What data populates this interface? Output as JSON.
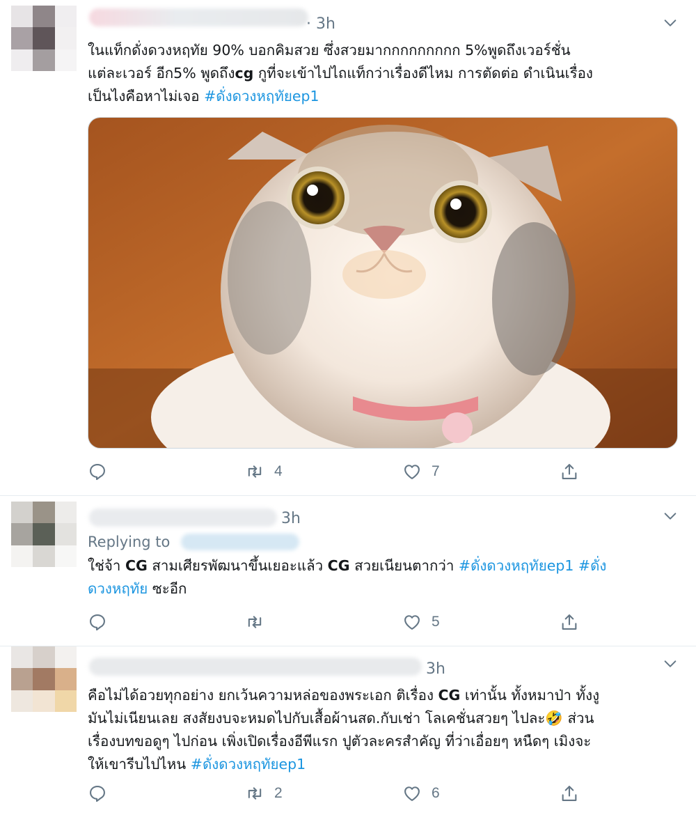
{
  "tweets": [
    {
      "time": "· 3h",
      "text": [
        {
          "t": "ในแท็กดั่งดวงหฤทัย 90% บอกคิมสวย ซึ่งสวยมากกกกกกกกก 5%พูดถึงเวอร์ชั่น",
          "s": "plain",
          "br": true
        },
        {
          "t": "แต่ละเวอร์ อีก5% พูดถึง",
          "s": "plain"
        },
        {
          "t": "cg",
          "s": "bold"
        },
        {
          "t": " กูที่จะเข้าไปไถแท็กว่าเรื่องดีไหม การตัดต่อ ดำเนินเรื่อง",
          "s": "plain",
          "br": true
        },
        {
          "t": "เป็นไงคือหาไม่เจอ ",
          "s": "plain"
        },
        {
          "t": "#ดั่งดวงหฤทัยep1",
          "s": "tag"
        }
      ],
      "retweets": "4",
      "likes": "7"
    },
    {
      "time": "3h",
      "replying_label": "Replying to",
      "text": [
        {
          "t": "ใช่จ้า ",
          "s": "plain"
        },
        {
          "t": "CG",
          "s": "bold"
        },
        {
          "t": " สามเศียรพัฒนาขึ้นเยอะแล้ว ",
          "s": "plain"
        },
        {
          "t": "CG",
          "s": "bold"
        },
        {
          "t": " สวยเนียนตากว่า ",
          "s": "plain"
        },
        {
          "t": "#ดั่งดวงหฤทัยep1",
          "s": "tag"
        },
        {
          "t": " #ดั่ง",
          "s": "tag",
          "br": true
        },
        {
          "t": "ดวงหฤทัย",
          "s": "tag"
        },
        {
          "t": " ซะอีก",
          "s": "plain"
        }
      ],
      "retweets": "",
      "likes": "5"
    },
    {
      "time": "3h",
      "text": [
        {
          "t": "คือไม่ได้อวยทุกอย่าง ยกเว้นความหล่อของพระเอก ติเรื่อง ",
          "s": "plain"
        },
        {
          "t": "CG",
          "s": "bold"
        },
        {
          "t": " เท่านั้น ทั้งหมาป่า ทั้งงู",
          "s": "plain",
          "br": true
        },
        {
          "t": "มันไม่เนียนเลย สงสัยงบจะหมดไปกับเสื้อผ้านสด.กับเช่า โลเคชั่นสวยๆ ไปละ🤣 ส่วน",
          "s": "plain",
          "br": true
        },
        {
          "t": "เรื่องบทขอดูๆ ไปก่อน เพิ่งเปิดเรื่องอีพีแรก ปูตัวละครสำคัญ ที่ว่าเอื่อยๆ หนืดๆ เมิงจะ",
          "s": "plain",
          "br": true
        },
        {
          "t": "ให้เขารีบไปไหน ",
          "s": "plain"
        },
        {
          "t": "#ดั่งดวงหฤทัยep1",
          "s": "tag"
        }
      ],
      "retweets": "2",
      "likes": "6"
    }
  ],
  "icons": {
    "reply": "comment-icon",
    "retweet": "retweet-icon",
    "like": "heart-icon",
    "share": "share-icon",
    "more": "chevron-down-icon"
  },
  "colors": {
    "link": "#1b95e0",
    "muted": "#657786",
    "text": "#14171a",
    "divider": "#e6ecf0"
  }
}
